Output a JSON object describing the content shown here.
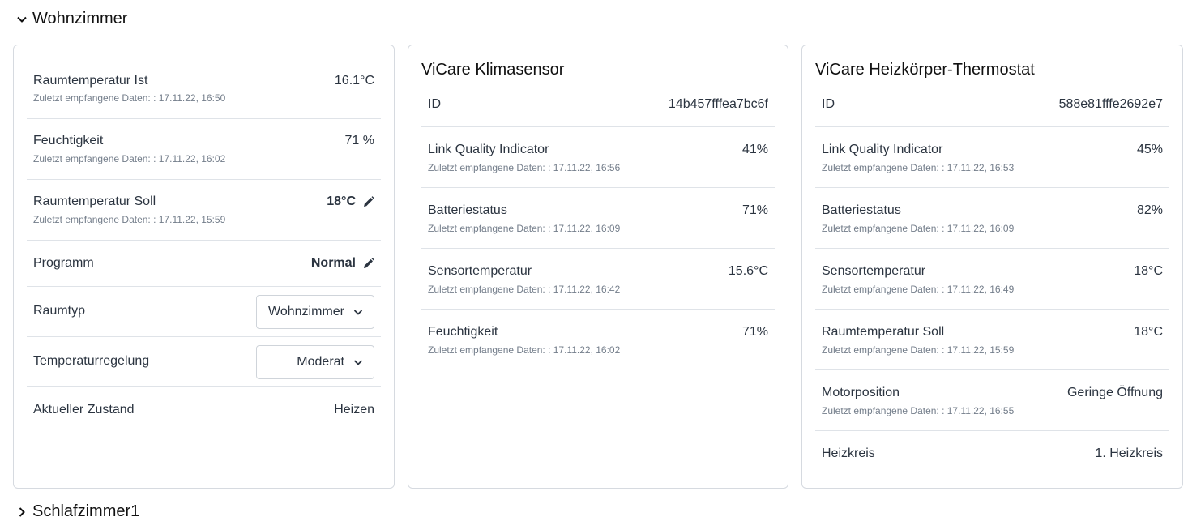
{
  "section": {
    "title": "Wohnzimmer",
    "next_title": "Schlafzimmer1"
  },
  "room": {
    "rows": [
      {
        "label": "Raumtemperatur Ist",
        "value": "16.1°C",
        "sub": "Zuletzt empfangene Daten: : 17.11.22, 16:50"
      },
      {
        "label": "Feuchtigkeit",
        "value": "71 %",
        "sub": "Zuletzt empfangene Daten: : 17.11.22, 16:02"
      },
      {
        "label": "Raumtemperatur Soll",
        "value": "18°C",
        "sub": "Zuletzt empfangene Daten: : 17.11.22, 15:59"
      },
      {
        "label": "Programm",
        "value": "Normal"
      },
      {
        "label": "Raumtyp",
        "value": "Wohnzimmer"
      },
      {
        "label": "Temperaturregelung",
        "value": "Moderat"
      },
      {
        "label": "Aktueller Zustand",
        "value": "Heizen"
      }
    ]
  },
  "sensor": {
    "title": "ViCare Klimasensor",
    "rows": [
      {
        "label": "ID",
        "value": "14b457fffea7bc6f"
      },
      {
        "label": "Link Quality Indicator",
        "value": "41%",
        "sub": "Zuletzt empfangene Daten: : 17.11.22, 16:56"
      },
      {
        "label": "Batteriestatus",
        "value": "71%",
        "sub": "Zuletzt empfangene Daten: : 17.11.22, 16:09"
      },
      {
        "label": "Sensortemperatur",
        "value": "15.6°C",
        "sub": "Zuletzt empfangene Daten: : 17.11.22, 16:42"
      },
      {
        "label": "Feuchtigkeit",
        "value": "71%",
        "sub": "Zuletzt empfangene Daten: : 17.11.22, 16:02"
      }
    ]
  },
  "thermostat": {
    "title": "ViCare Heizkörper-Thermostat",
    "rows": [
      {
        "label": "ID",
        "value": "588e81fffe2692e7"
      },
      {
        "label": "Link Quality Indicator",
        "value": "45%",
        "sub": "Zuletzt empfangene Daten: : 17.11.22, 16:53"
      },
      {
        "label": "Batteriestatus",
        "value": "82%",
        "sub": "Zuletzt empfangene Daten: : 17.11.22, 16:09"
      },
      {
        "label": "Sensortemperatur",
        "value": "18°C",
        "sub": "Zuletzt empfangene Daten: : 17.11.22, 16:49"
      },
      {
        "label": "Raumtemperatur Soll",
        "value": "18°C",
        "sub": "Zuletzt empfangene Daten: : 17.11.22, 15:59"
      },
      {
        "label": "Motorposition",
        "value": "Geringe Öffnung",
        "sub": "Zuletzt empfangene Daten: : 17.11.22, 16:55"
      },
      {
        "label": "Heizkreis",
        "value": "1. Heizkreis"
      }
    ]
  },
  "icons": {
    "collapse": "chevron-down-icon",
    "expand": "chevron-right-icon",
    "edit": "pencil-icon",
    "select": "chevron-down-icon"
  },
  "colors": {
    "text": "#2b3440",
    "muted": "#737d8a",
    "border": "#d6dae0"
  }
}
